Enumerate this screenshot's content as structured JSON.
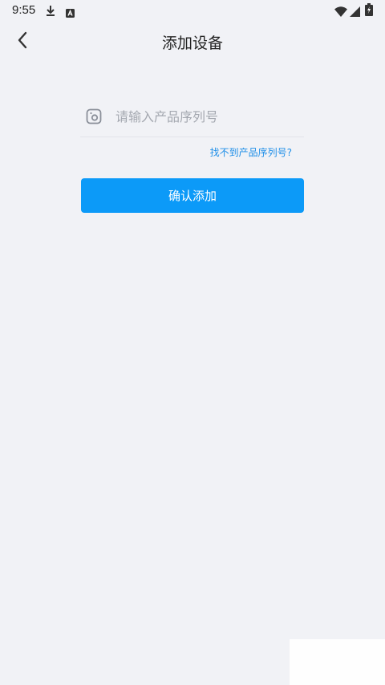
{
  "status_bar": {
    "time": "9:55",
    "icons": [
      "download-icon",
      "app-notification-icon",
      "wifi-icon",
      "signal-icon",
      "battery-charging-icon"
    ]
  },
  "nav": {
    "title": "添加设备",
    "back_icon": "chevron-left-icon"
  },
  "form": {
    "serial_placeholder": "请输入产品序列号",
    "serial_value": "",
    "serial_icon": "device-icon",
    "help_link": "找不到产品序列号?",
    "confirm_label": "确认添加"
  },
  "colors": {
    "background": "#f1f2f6",
    "accent": "#0c9af8",
    "link": "#1f8fe8"
  }
}
